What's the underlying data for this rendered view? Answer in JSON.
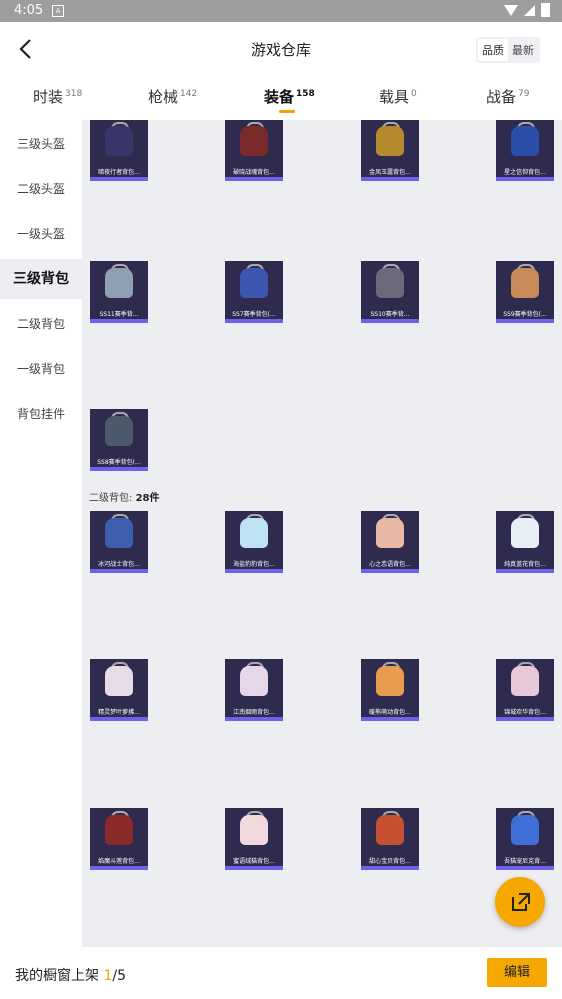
{
  "status_bar": {
    "time": "4:05",
    "notification_icon": "A"
  },
  "header": {
    "title": "游戏仓库",
    "sort": {
      "quality": "品质",
      "newest": "最新"
    }
  },
  "tabs": [
    {
      "label": "时装",
      "count": "318"
    },
    {
      "label": "枪械",
      "count": "142"
    },
    {
      "label": "装备",
      "count": "158"
    },
    {
      "label": "载具",
      "count": "0"
    },
    {
      "label": "战备",
      "count": "79"
    }
  ],
  "sidebar": [
    {
      "label": "三级头盔"
    },
    {
      "label": "二级头盔"
    },
    {
      "label": "一级头盔"
    },
    {
      "label": "三级背包"
    },
    {
      "label": "二级背包"
    },
    {
      "label": "一级背包"
    },
    {
      "label": "背包挂件"
    }
  ],
  "section2": {
    "title": "二级背包:",
    "count": "28件"
  },
  "items": [
    {
      "label": "暗夜行者背包...",
      "color": "#3a3568"
    },
    {
      "label": "破晓战魂背包...",
      "color": "#7a2a2a"
    },
    {
      "label": "金凤玉露背包...",
      "color": "#b58a2c"
    },
    {
      "label": "星之信仰背包...",
      "color": "#2b4fa8"
    },
    {
      "label": "SS11赛季背...",
      "color": "#8fa0b3"
    },
    {
      "label": "SS7赛季背包(...",
      "color": "#3d56b0"
    },
    {
      "label": "SS10赛季背...",
      "color": "#6a6a7a"
    },
    {
      "label": "SS9赛季背包(...",
      "color": "#c98a5a"
    },
    {
      "label": "SS8赛季背包(...",
      "color": "#4a5a6a"
    },
    {
      "label": "冰河战士背包...",
      "color": "#3c5fae"
    },
    {
      "label": "海盐豹豹背包...",
      "color": "#bfe3f2"
    },
    {
      "label": "心之恋语背包...",
      "color": "#e9b8a4"
    },
    {
      "label": "纯真蓝花背包...",
      "color": "#e7eef5"
    },
    {
      "label": "精灵梦叶萝拂...",
      "color": "#e8dce8"
    },
    {
      "label": "江南烟雨背包...",
      "color": "#e7d6ea"
    },
    {
      "label": "暖熊萌动背包...",
      "color": "#e89c4c"
    },
    {
      "label": "锦城欢华背包...",
      "color": "#e8c9d9"
    },
    {
      "label": "焰魔斗莲背包...",
      "color": "#8a2a2a"
    },
    {
      "label": "蜜语绒猫背包...",
      "color": "#f2d9de"
    },
    {
      "label": "甜心宝贝背包...",
      "color": "#c4502f"
    },
    {
      "label": "吾猫宠尼克背...",
      "color": "#3f6fd6"
    }
  ],
  "bottom": {
    "showcase_label": "我的橱窗上架",
    "current": "1",
    "total": "/5",
    "edit": "编辑"
  }
}
